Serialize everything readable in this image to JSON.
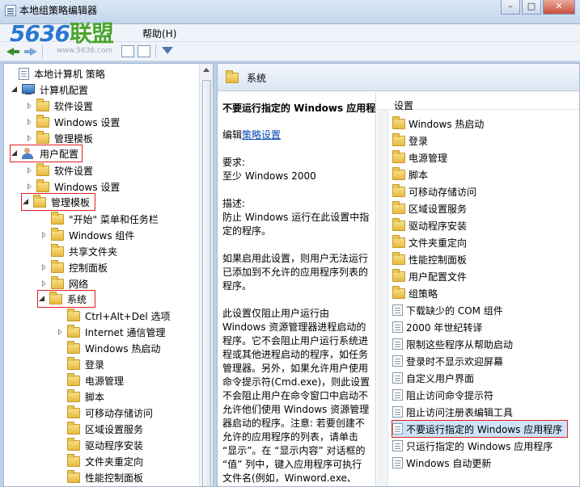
{
  "window": {
    "title": "本地组策略编辑器",
    "buttons": [
      "–",
      "□",
      "✕"
    ]
  },
  "menu": {
    "help_label": "帮助(H)"
  },
  "watermark": {
    "logo_num": "5636",
    "logo_text": "联盟",
    "url": "www.5636.com"
  },
  "tree": {
    "root": "本地计算机 策略",
    "computer_config": "计算机配置",
    "cc_software": "软件设置",
    "cc_windows": "Windows 设置",
    "cc_admin": "管理模板",
    "user_config": "用户配置",
    "uc_software": "软件设置",
    "uc_windows": "Windows 设置",
    "uc_admin": "管理模板",
    "start_menu": "\"开始\" 菜单和任务栏",
    "win_components": "Windows 组件",
    "shared_folders": "共享文件夹",
    "control_panel": "控制面板",
    "network": "网络",
    "system": "系统",
    "sys_cad": "Ctrl+Alt+Del 选项",
    "sys_internet": "Internet 通信管理",
    "sys_win_hotstart": "Windows 热启动",
    "sys_logon": "登录",
    "sys_power": "电源管理",
    "sys_scripts": "脚本",
    "sys_removable": "可移动存储访问",
    "sys_locale": "区域设置服务",
    "sys_driver": "驱动程序安装",
    "sys_redirect": "文件夹重定向",
    "sys_perf": "性能控制面板"
  },
  "right": {
    "header_title": "系统",
    "desc": {
      "title": "不要运行指定的 Windows 应用程序",
      "edit_prefix": "编辑",
      "edit_link": "策略设置",
      "req_label": "要求:",
      "req_value": "至少 Windows 2000",
      "desc_label": "描述:",
      "desc_text": "防止 Windows 运行在此设置中指定的程序。",
      "p2": "如果启用此设置，则用户无法运行已添加到不允许的应用程序列表的程序。",
      "p3": "此设置仅阻止用户运行由 Windows 资源管理器进程启动的程序。它不会阻止用户运行系统进程或其他进程启动的程序，如任务管理器。另外，如果允许用户使用命令提示符(Cmd.exe)，则此设置不会阻止用户在命令窗口中启动不允许他们使用 Windows 资源管理器启动的程序。注意: 若要创建不允许的应用程序的列表，请单击 “显示”。在 “显示内容” 对话框的 “值” 列中，键入应用程序可执行文件名(例如，Winword.exe、"
    },
    "settings_header": "设置",
    "settings": [
      {
        "label": "Windows 热启动",
        "type": "folder"
      },
      {
        "label": "登录",
        "type": "folder"
      },
      {
        "label": "电源管理",
        "type": "folder"
      },
      {
        "label": "脚本",
        "type": "folder"
      },
      {
        "label": "可移动存储访问",
        "type": "folder"
      },
      {
        "label": "区域设置服务",
        "type": "folder"
      },
      {
        "label": "驱动程序安装",
        "type": "folder"
      },
      {
        "label": "文件夹重定向",
        "type": "folder"
      },
      {
        "label": "性能控制面板",
        "type": "folder"
      },
      {
        "label": "用户配置文件",
        "type": "folder"
      },
      {
        "label": "组策略",
        "type": "folder"
      },
      {
        "label": "下载缺少的 COM 组件",
        "type": "policy"
      },
      {
        "label": "2000 年世纪转译",
        "type": "policy"
      },
      {
        "label": "限制这些程序从帮助启动",
        "type": "policy"
      },
      {
        "label": "登录时不显示欢迎屏幕",
        "type": "policy"
      },
      {
        "label": "自定义用户界面",
        "type": "policy"
      },
      {
        "label": "阻止访问命令提示符",
        "type": "policy"
      },
      {
        "label": "阻止访问注册表编辑工具",
        "type": "policy"
      },
      {
        "label": "不要运行指定的 Windows 应用程序",
        "type": "policy",
        "selected": true
      },
      {
        "label": "只运行指定的 Windows 应用程序",
        "type": "policy"
      },
      {
        "label": "Windows 自动更新",
        "type": "policy"
      }
    ]
  },
  "colors": {
    "highlight_border": "#e02020",
    "selection": "#cde3f8",
    "link": "#0645ad"
  }
}
